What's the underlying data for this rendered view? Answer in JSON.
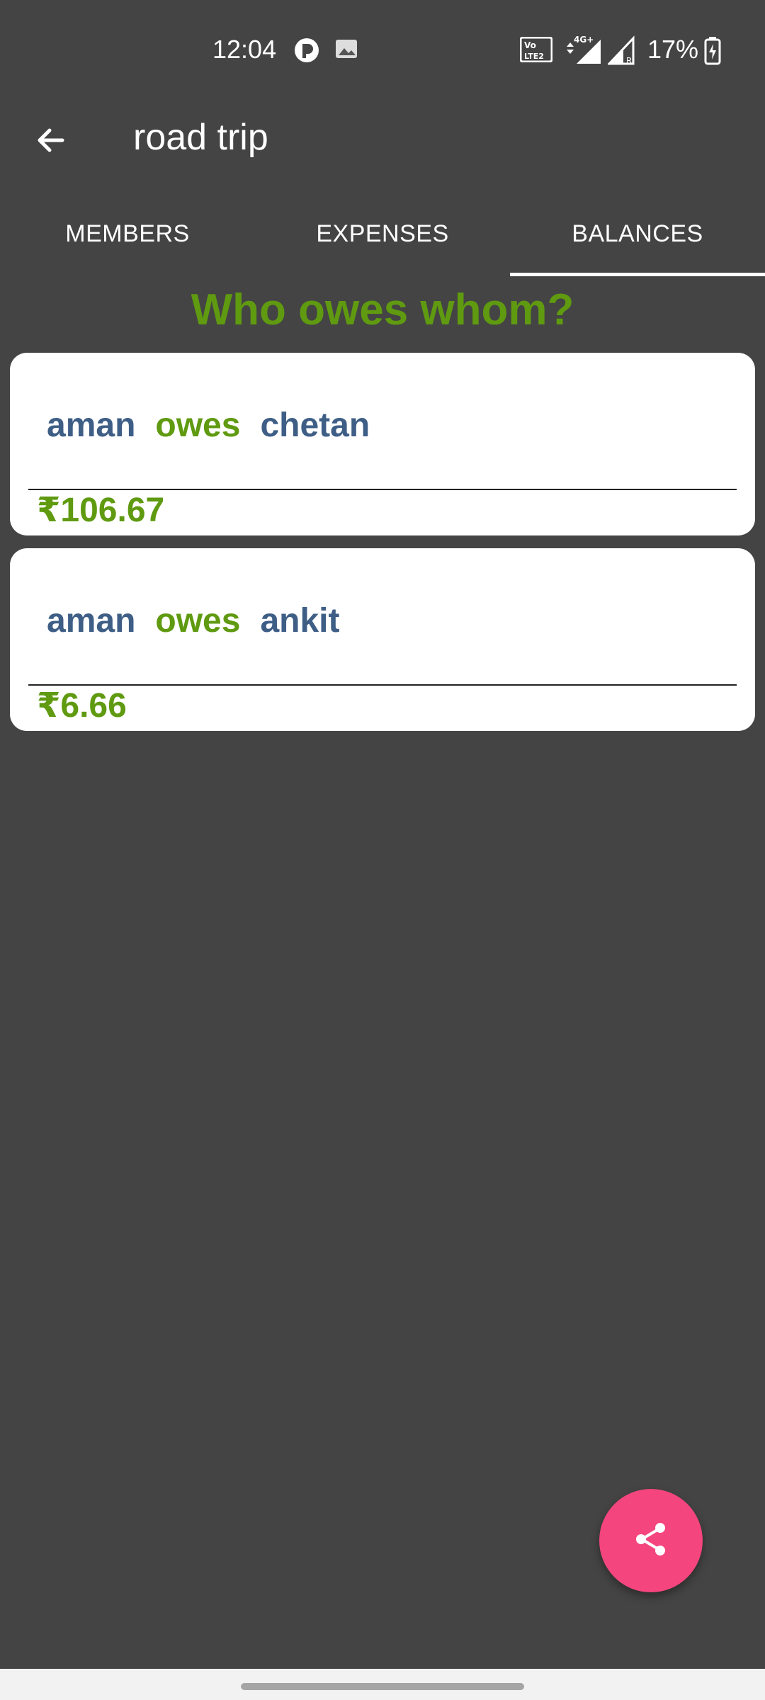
{
  "status_bar": {
    "time": "12:04",
    "network": "4G+",
    "battery": "17%"
  },
  "app_bar": {
    "title": "road trip"
  },
  "tabs": [
    {
      "label": "MEMBERS",
      "selected": false
    },
    {
      "label": "EXPENSES",
      "selected": false
    },
    {
      "label": "BALANCES",
      "selected": true
    }
  ],
  "heading": "Who owes whom?",
  "balances": [
    {
      "debtor": "aman",
      "verb": "owes",
      "creditor": "chetan",
      "amount": "₹106.67"
    },
    {
      "debtor": "aman",
      "verb": "owes",
      "creditor": "ankit",
      "amount": "₹6.66"
    }
  ],
  "colors": {
    "background": "#444444",
    "accent_green": "#5f9a10",
    "name_blue": "#3e5e86",
    "fab_pink": "#f4457f"
  },
  "icons": {
    "back": "arrow-left-icon",
    "fab": "share-icon"
  }
}
